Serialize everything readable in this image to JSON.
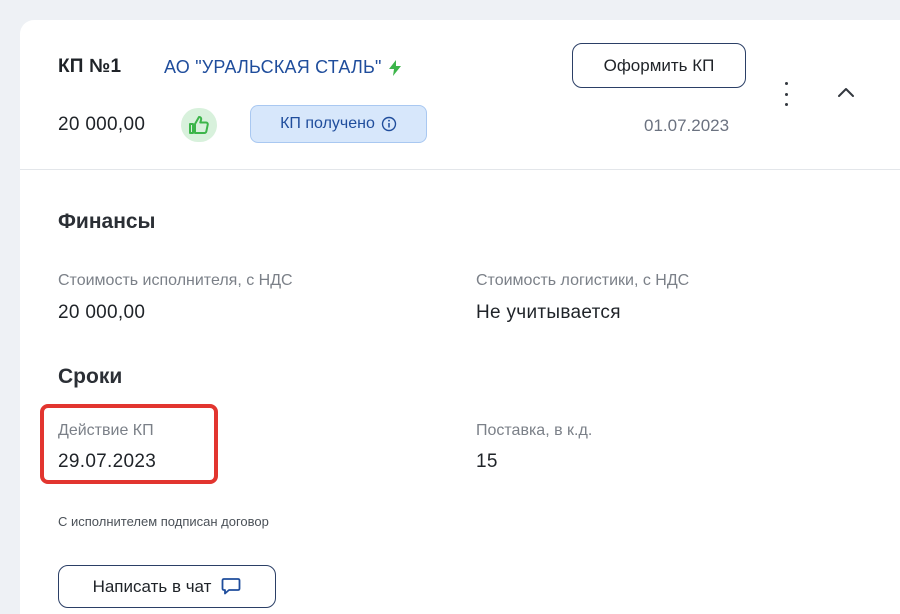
{
  "colors": {
    "accent_blue": "#1f4d9c",
    "bolt_green": "#3cb54a",
    "like_green": "#3cb54a",
    "status_bg": "#d7e7fb",
    "highlight_red": "#e2352f"
  },
  "header": {
    "kp_number": "КП №1",
    "company": "АО \"УРАЛЬСКАЯ СТАЛЬ\"",
    "issue_button_label": "Оформить КП",
    "amount": "20 000,00",
    "status": "КП получено",
    "date": "01.07.2023"
  },
  "finance": {
    "title": "Финансы",
    "contractor_cost_label": "Стоимость исполнителя, с НДС",
    "contractor_cost_value": "20 000,00",
    "logistics_cost_label": "Стоимость логистики, с НДС",
    "logistics_cost_value": "Не учитывается"
  },
  "terms": {
    "title": "Сроки",
    "validity_label": "Действие КП",
    "validity_value": "29.07.2023",
    "delivery_label": "Поставка, в к.д.",
    "delivery_value": "15"
  },
  "contract_note": "С исполнителем подписан договор",
  "chat_button_label": "Написать в чат",
  "icons": [
    "bolt-icon",
    "thumbs-up-icon",
    "info-icon",
    "more-vertical-icon",
    "chevron-up-icon",
    "chat-icon"
  ]
}
